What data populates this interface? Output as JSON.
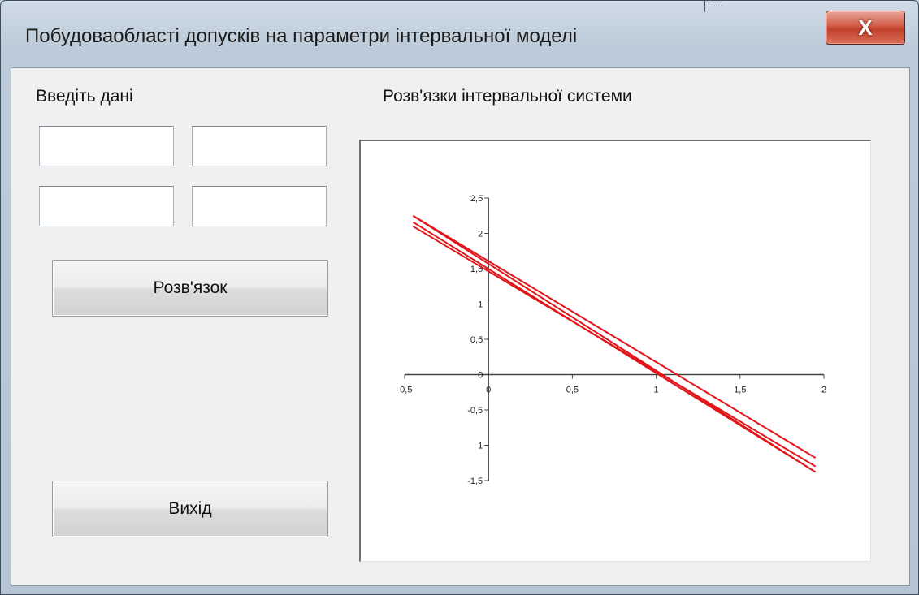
{
  "window": {
    "title": "Побудоваобласті допусків на параметри інтервальної моделі",
    "close_glyph": "X",
    "grip_glyph": "...."
  },
  "form": {
    "input_label": "Введіть дані",
    "chart_label": "Розв'язки інтервальної системи",
    "inputs": [
      "",
      "",
      "",
      ""
    ],
    "solve_button": "Розв'язок",
    "exit_button": "Вихід"
  },
  "chart_data": {
    "type": "line",
    "title": "",
    "xlabel": "",
    "ylabel": "",
    "xlim": [
      -0.5,
      2
    ],
    "ylim": [
      -1.5,
      2.5
    ],
    "x_ticks": [
      "-0,5",
      "0",
      "0,5",
      "1",
      "1,5",
      "2"
    ],
    "y_ticks": [
      "2,5",
      "2",
      "1,5",
      "1",
      "0,5",
      "0",
      "-0,5",
      "-1",
      "-1,5"
    ],
    "grid": false,
    "legend": "none",
    "line_color": "#e0161b",
    "series": [
      {
        "x": [
          -0.45,
          1.95
        ],
        "y": [
          2.1,
          -1.3
        ]
      },
      {
        "x": [
          -0.45,
          1.95
        ],
        "y": [
          2.16,
          -1.38
        ]
      },
      {
        "x": [
          -0.45,
          1.95
        ],
        "y": [
          2.25,
          -1.38
        ]
      },
      {
        "x": [
          -0.45,
          1.95
        ],
        "y": [
          2.25,
          -1.18
        ]
      }
    ]
  }
}
